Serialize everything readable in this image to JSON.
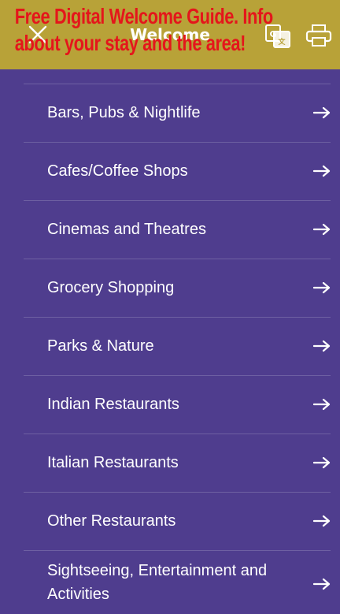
{
  "header": {
    "title": "Welcome",
    "banner_line1": "Free Digital Welcome Guide. Info",
    "banner_line2": "about your stay and the area!"
  },
  "menu": {
    "items": [
      {
        "label": "Bars, Pubs & Nightlife"
      },
      {
        "label": "Cafes/Coffee Shops"
      },
      {
        "label": "Cinemas and Theatres"
      },
      {
        "label": "Grocery Shopping"
      },
      {
        "label": "Parks & Nature"
      },
      {
        "label": "Indian Restaurants"
      },
      {
        "label": "Italian Restaurants"
      },
      {
        "label": "Other Restaurants"
      },
      {
        "label": "Sightseeing, Entertainment and Activities"
      }
    ]
  },
  "colors": {
    "background": "#4f3d8e",
    "header_bg": "#b8a238",
    "banner_text": "#e4161b",
    "text": "#ffffff"
  }
}
